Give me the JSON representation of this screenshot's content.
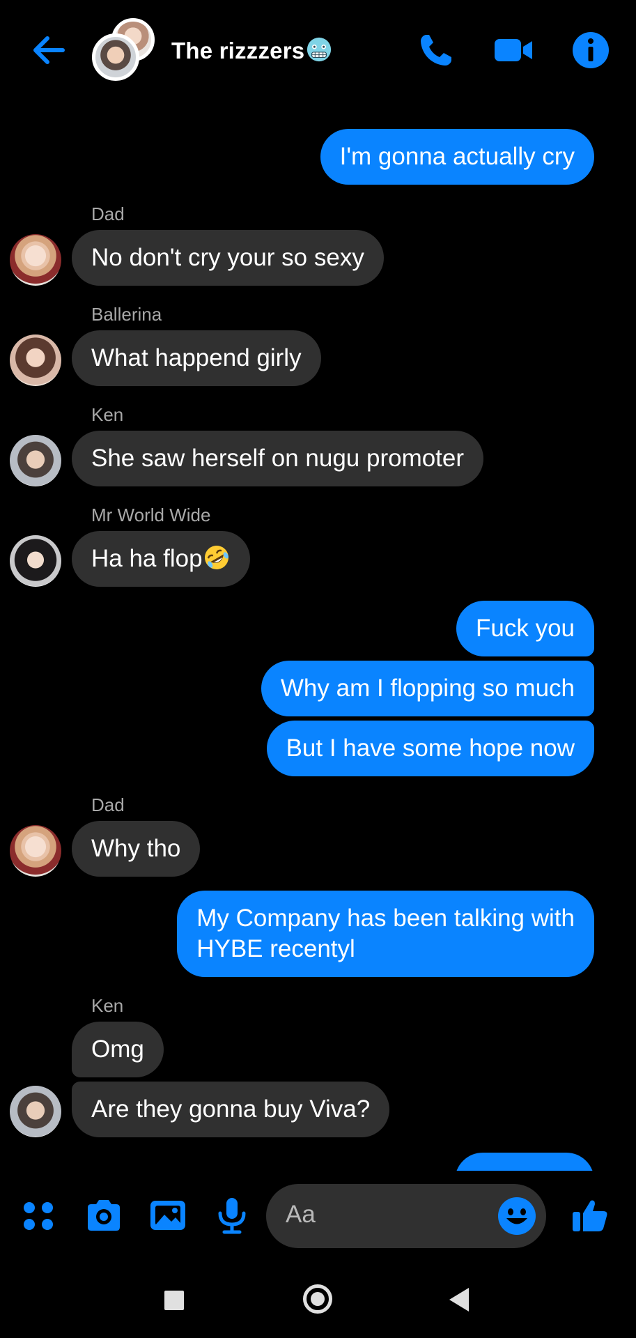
{
  "header": {
    "title": "The rizzzers",
    "icons": [
      "back-arrow-icon",
      "phone-icon",
      "video-camera-icon",
      "info-icon"
    ]
  },
  "messages": [
    {
      "side": "out",
      "text": "I'm gonna actually cry"
    },
    {
      "side": "in",
      "sender": "Dad",
      "text": "No don't cry your so sexy"
    },
    {
      "side": "in",
      "sender": "Ballerina",
      "text": "What happend girly"
    },
    {
      "side": "in",
      "sender": "Ken",
      "text": "She saw herself on nugu promoter"
    },
    {
      "side": "in",
      "sender": "Mr World Wide",
      "text": "Ha ha flop",
      "emoji": "rofl-emoji"
    },
    {
      "side": "out",
      "text": "Fuck you"
    },
    {
      "side": "out",
      "text": "Why am I flopping so much"
    },
    {
      "side": "out",
      "text": "But I have some hope now"
    },
    {
      "side": "in",
      "sender": "Dad",
      "text": "Why tho"
    },
    {
      "side": "out",
      "lines": [
        "My Company has been talking with",
        "HYBE recentyl"
      ]
    },
    {
      "side": "in",
      "sender": "Ken",
      "text": "Omg"
    },
    {
      "side": "in",
      "text": "Are they gonna buy Viva?"
    }
  ],
  "composer": {
    "placeholder": "Aa",
    "icons": [
      "apps-grid-icon",
      "camera-icon",
      "gallery-icon",
      "microphone-icon",
      "emoji-icon",
      "thumbs-up-icon"
    ]
  },
  "colors": {
    "accent": "#0a84ff",
    "incoming_bubble": "#303030",
    "background": "#000000"
  }
}
